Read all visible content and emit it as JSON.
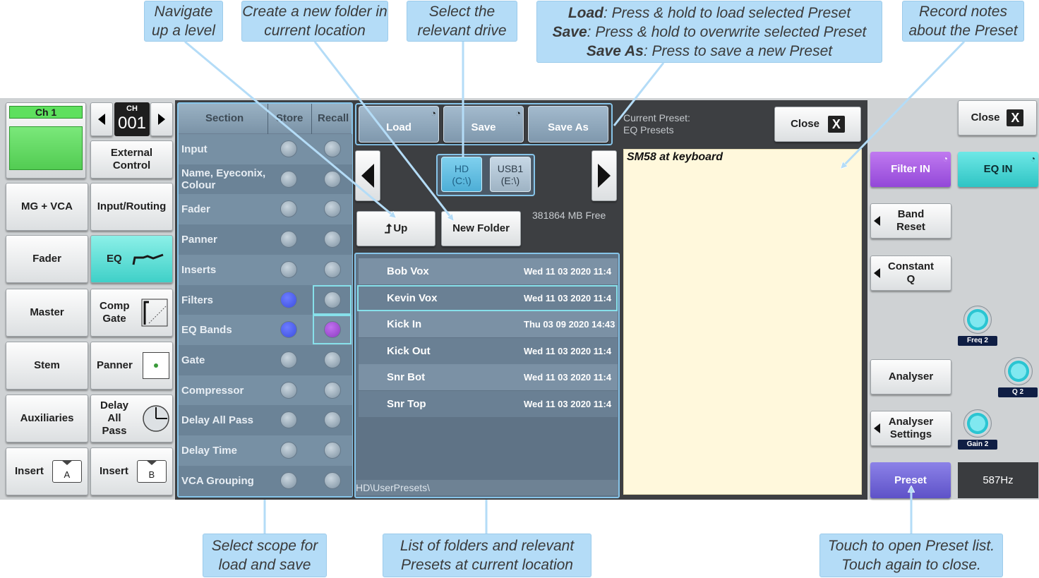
{
  "callouts": {
    "navigate_up": "Navigate up a level",
    "new_folder": "Create a new folder in current location",
    "select_drive": "Select the relevant drive",
    "load_label": "Load",
    "load_desc": ": Press & hold to load selected Preset",
    "save_label": "Save",
    "save_desc": ": Press & hold to overwrite selected Preset",
    "saveas_label": "Save As",
    "saveas_desc": ": Press to save a new Preset",
    "record_notes": "Record notes about the Preset",
    "select_scope": "Select scope for load and save",
    "list_folders": "List of folders and relevant Presets at current location",
    "touch_preset": "Touch to open Preset list. Touch again to close."
  },
  "left_nav": {
    "channel_name": "Ch 1",
    "ch_label": "CH",
    "ch_number": "001",
    "external_control": "External Control",
    "mg_vca": "MG + VCA",
    "input_routing": "Input/Routing",
    "fader": "Fader",
    "eq": "EQ",
    "master": "Master",
    "comp_gate": "Comp Gate",
    "stem": "Stem",
    "panner": "Panner",
    "auxiliaries": "Auxiliaries",
    "delay_all_pass": "Delay All Pass",
    "insert_a_label": "Insert",
    "insert_a_tag": "A",
    "insert_b_label": "Insert",
    "insert_b_tag": "B"
  },
  "scope": {
    "headers": {
      "section": "Section",
      "store": "Store",
      "recall": "Recall"
    },
    "rows": [
      {
        "label": "Input",
        "store": false,
        "recall": false
      },
      {
        "label": "Name, Eyeconix, Colour",
        "store": false,
        "recall": false
      },
      {
        "label": "Fader",
        "store": false,
        "recall": false
      },
      {
        "label": "Panner",
        "store": false,
        "recall": false
      },
      {
        "label": "Inserts",
        "store": false,
        "recall": false
      },
      {
        "label": "Filters",
        "store": true,
        "recall": false
      },
      {
        "label": "EQ Bands",
        "store": true,
        "recall": true
      },
      {
        "label": "Gate",
        "store": false,
        "recall": false
      },
      {
        "label": "Compressor",
        "store": false,
        "recall": false
      },
      {
        "label": "Delay All Pass",
        "store": false,
        "recall": false
      },
      {
        "label": "Delay Time",
        "store": false,
        "recall": false
      },
      {
        "label": "VCA Grouping",
        "store": false,
        "recall": false
      }
    ]
  },
  "browser": {
    "load": "Load",
    "save": "Save",
    "save_as": "Save As",
    "drive_hd": "HD",
    "drive_hd_path": "(C:\\)",
    "drive_usb": "USB1",
    "drive_usb_path": "(E:\\)",
    "up": "Up",
    "new_folder": "New Folder",
    "free_space": "381864 MB Free",
    "files": [
      {
        "name": "Bob Vox",
        "date": "Wed 11 03 2020 11:4"
      },
      {
        "name": "Kevin Vox",
        "date": "Wed 11 03 2020 11:4"
      },
      {
        "name": "Kick In",
        "date": "Thu 03 09 2020 14:43"
      },
      {
        "name": "Kick Out",
        "date": "Wed 11 03 2020 11:4"
      },
      {
        "name": "Snr Bot",
        "date": "Wed 11 03 2020 11:4"
      },
      {
        "name": "Snr Top",
        "date": "Wed 11 03 2020 11:4"
      }
    ],
    "path": "HD\\UserPresets\\"
  },
  "preset": {
    "current_label": "Current Preset:",
    "current_name": "EQ Presets",
    "close": "Close",
    "close_icon": "X",
    "notes": "SM58 at keyboard"
  },
  "right_panel": {
    "close": "Close",
    "close_icon": "X",
    "filter_in": "Filter IN",
    "eq_in": "EQ IN",
    "band_reset": "Band Reset",
    "constant_q": "Constant Q",
    "freq_label": "Freq 2",
    "q_label": "Q 2",
    "gain_label": "Gain 2",
    "analyser": "Analyser",
    "analyser_settings": "Analyser Settings",
    "preset": "Preset",
    "freq_readout": "587Hz"
  },
  "colors": {
    "callout": "#b4dcf7",
    "teal_button": "#3fd0c8",
    "filter_in": "#a35ce6",
    "preset_button": "#6a5fcf",
    "notes_background": "#fff8dc",
    "store_active": "#3b4fe0",
    "recall_active": "#8c3cc0"
  }
}
